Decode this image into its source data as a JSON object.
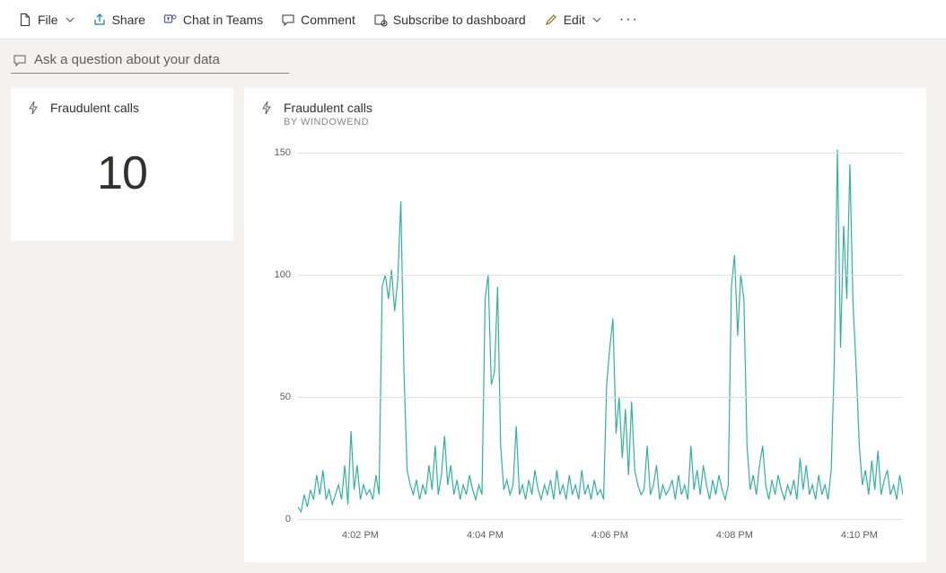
{
  "toolbar": {
    "file": "File",
    "share": "Share",
    "chat": "Chat in Teams",
    "comment": "Comment",
    "subscribe": "Subscribe to dashboard",
    "edit": "Edit"
  },
  "qna": {
    "placeholder": "Ask a question about your data"
  },
  "tile_small": {
    "title": "Fraudulent calls",
    "value": "10"
  },
  "tile_large": {
    "title": "Fraudulent calls",
    "subtitle": "BY WINDOWEND"
  },
  "chart_data": {
    "type": "line",
    "ylim": [
      0,
      155
    ],
    "y_ticks": [
      0,
      50,
      100,
      150
    ],
    "x_minutes": [
      1,
      2,
      3,
      4,
      5,
      6,
      7,
      8,
      9,
      10
    ],
    "x_tick_labels": {
      "2": "4:02 PM",
      "4": "4:04 PM",
      "6": "4:06 PM",
      "8": "4:08 PM",
      "10": "4:10 PM"
    },
    "series": [
      {
        "name": "Fraudulent calls",
        "color": "#30b1a0",
        "x": [
          1.0,
          1.05,
          1.1,
          1.15,
          1.2,
          1.25,
          1.3,
          1.35,
          1.4,
          1.45,
          1.5,
          1.55,
          1.6,
          1.65,
          1.7,
          1.75,
          1.8,
          1.85,
          1.9,
          1.95,
          2.0,
          2.05,
          2.1,
          2.15,
          2.2,
          2.25,
          2.3,
          2.35,
          2.4,
          2.45,
          2.5,
          2.55,
          2.6,
          2.65,
          2.7,
          2.75,
          2.8,
          2.85,
          2.9,
          2.95,
          3.0,
          3.05,
          3.1,
          3.15,
          3.2,
          3.25,
          3.3,
          3.35,
          3.4,
          3.45,
          3.5,
          3.55,
          3.6,
          3.65,
          3.7,
          3.75,
          3.8,
          3.85,
          3.9,
          3.95,
          4.0,
          4.05,
          4.1,
          4.15,
          4.2,
          4.25,
          4.3,
          4.35,
          4.4,
          4.45,
          4.5,
          4.55,
          4.6,
          4.65,
          4.7,
          4.75,
          4.8,
          4.85,
          4.9,
          4.95,
          5.0,
          5.05,
          5.1,
          5.15,
          5.2,
          5.25,
          5.3,
          5.35,
          5.4,
          5.45,
          5.5,
          5.55,
          5.6,
          5.65,
          5.7,
          5.75,
          5.8,
          5.85,
          5.9,
          5.95,
          6.0,
          6.05,
          6.1,
          6.15,
          6.2,
          6.25,
          6.3,
          6.35,
          6.4,
          6.45,
          6.5,
          6.55,
          6.6,
          6.65,
          6.7,
          6.75,
          6.8,
          6.85,
          6.9,
          6.95,
          7.0,
          7.05,
          7.1,
          7.15,
          7.2,
          7.25,
          7.3,
          7.35,
          7.4,
          7.45,
          7.5,
          7.55,
          7.6,
          7.65,
          7.7,
          7.75,
          7.8,
          7.85,
          7.9,
          7.95,
          8.0,
          8.05,
          8.1,
          8.15,
          8.2,
          8.25,
          8.3,
          8.35,
          8.4,
          8.45,
          8.5,
          8.55,
          8.6,
          8.65,
          8.7,
          8.75,
          8.8,
          8.85,
          8.9,
          8.95,
          9.0,
          9.05,
          9.1,
          9.15,
          9.2,
          9.25,
          9.3,
          9.35,
          9.4,
          9.45,
          9.5,
          9.55,
          9.6,
          9.65,
          9.7,
          9.75,
          9.8,
          9.85,
          9.9,
          9.95,
          10.0,
          10.05,
          10.1,
          10.15,
          10.2,
          10.25,
          10.3,
          10.35,
          10.4,
          10.45,
          10.5,
          10.55,
          10.6,
          10.65,
          10.7
        ],
        "values": [
          5,
          3,
          10,
          5,
          12,
          8,
          18,
          10,
          20,
          8,
          12,
          6,
          10,
          14,
          8,
          22,
          6,
          36,
          12,
          22,
          8,
          14,
          10,
          12,
          8,
          18,
          10,
          95,
          100,
          90,
          102,
          85,
          98,
          130,
          60,
          20,
          14,
          10,
          16,
          8,
          14,
          10,
          22,
          12,
          30,
          10,
          18,
          34,
          14,
          22,
          10,
          16,
          8,
          14,
          10,
          18,
          12,
          8,
          14,
          10,
          90,
          100,
          55,
          60,
          95,
          30,
          12,
          16,
          10,
          14,
          38,
          10,
          14,
          8,
          16,
          10,
          20,
          12,
          8,
          14,
          10,
          16,
          8,
          20,
          10,
          14,
          8,
          18,
          10,
          14,
          8,
          20,
          10,
          14,
          8,
          16,
          10,
          12,
          8,
          55,
          70,
          82,
          35,
          50,
          25,
          45,
          18,
          48,
          20,
          14,
          10,
          12,
          30,
          10,
          14,
          22,
          8,
          14,
          10,
          12,
          16,
          8,
          18,
          10,
          14,
          8,
          30,
          12,
          20,
          10,
          22,
          14,
          8,
          16,
          10,
          18,
          12,
          8,
          14,
          95,
          108,
          75,
          100,
          90,
          30,
          12,
          18,
          10,
          22,
          30,
          14,
          8,
          16,
          10,
          18,
          12,
          8,
          14,
          10,
          16,
          8,
          25,
          12,
          22,
          10,
          14,
          8,
          18,
          10,
          14,
          8,
          20,
          65,
          151,
          70,
          120,
          90,
          145,
          88,
          62,
          30,
          14,
          20,
          10,
          24,
          12,
          28,
          10,
          16,
          20,
          10,
          14,
          8,
          18,
          10
        ]
      }
    ]
  }
}
